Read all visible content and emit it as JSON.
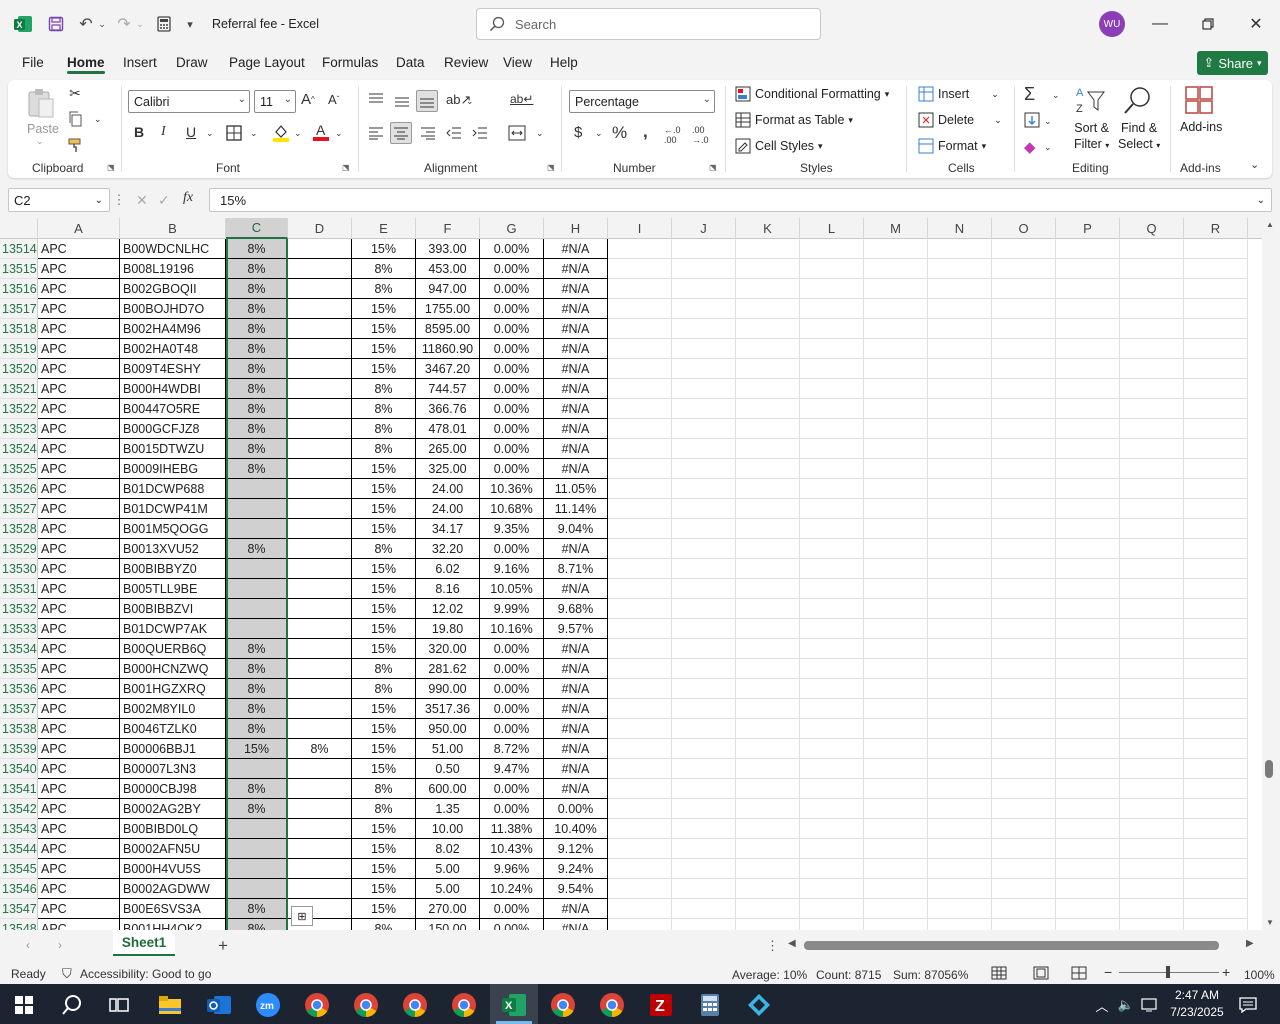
{
  "window": {
    "title": "Referral fee  -  Excel",
    "search_placeholder": "Search",
    "avatar_initials": "WU"
  },
  "menu": [
    "File",
    "Home",
    "Insert",
    "Draw",
    "Page Layout",
    "Formulas",
    "Data",
    "Review",
    "View",
    "Help"
  ],
  "share_label": "Share",
  "ribbon": {
    "clipboard": {
      "paste": "Paste",
      "label": "Clipboard"
    },
    "font": {
      "name": "Calibri",
      "size": "11",
      "label": "Font"
    },
    "alignment": {
      "label": "Alignment"
    },
    "number": {
      "format": "Percentage",
      "label": "Number"
    },
    "styles": {
      "conditional": "Conditional Formatting",
      "format_table": "Format as Table",
      "cell_styles": "Cell Styles",
      "label": "Styles"
    },
    "cells": {
      "insert": "Insert",
      "delete": "Delete",
      "format": "Format",
      "label": "Cells"
    },
    "editing": {
      "sort1": "Sort &",
      "sort2": "Filter",
      "find1": "Find &",
      "find2": "Select",
      "label": "Editing"
    },
    "addins": {
      "btn": "Add-ins",
      "label": "Add-ins"
    }
  },
  "formula_bar": {
    "cell_ref": "C2",
    "content": "15%",
    "fx": "fx"
  },
  "columns": [
    "A",
    "B",
    "C",
    "D",
    "E",
    "F",
    "G",
    "H",
    "I",
    "J",
    "K",
    "L",
    "M",
    "N",
    "O",
    "P",
    "Q",
    "R"
  ],
  "rows": [
    {
      "n": "13514",
      "a": "APC",
      "b": "B00WDCNLHC",
      "c": "8%",
      "d": "",
      "e": "15%",
      "f": "393.00",
      "g": "0.00%",
      "h": "#N/A"
    },
    {
      "n": "13515",
      "a": "APC",
      "b": "B008L19196",
      "c": "8%",
      "d": "",
      "e": "8%",
      "f": "453.00",
      "g": "0.00%",
      "h": "#N/A"
    },
    {
      "n": "13516",
      "a": "APC",
      "b": "B002GBOQII",
      "c": "8%",
      "d": "",
      "e": "8%",
      "f": "947.00",
      "g": "0.00%",
      "h": "#N/A"
    },
    {
      "n": "13517",
      "a": "APC",
      "b": "B00BOJHD7O",
      "c": "8%",
      "d": "",
      "e": "15%",
      "f": "1755.00",
      "g": "0.00%",
      "h": "#N/A"
    },
    {
      "n": "13518",
      "a": "APC",
      "b": "B002HA4M96",
      "c": "8%",
      "d": "",
      "e": "15%",
      "f": "8595.00",
      "g": "0.00%",
      "h": "#N/A"
    },
    {
      "n": "13519",
      "a": "APC",
      "b": "B002HA0T48",
      "c": "8%",
      "d": "",
      "e": "15%",
      "f": "11860.90",
      "g": "0.00%",
      "h": "#N/A"
    },
    {
      "n": "13520",
      "a": "APC",
      "b": "B009T4ESHY",
      "c": "8%",
      "d": "",
      "e": "15%",
      "f": "3467.20",
      "g": "0.00%",
      "h": "#N/A"
    },
    {
      "n": "13521",
      "a": "APC",
      "b": "B000H4WDBI",
      "c": "8%",
      "d": "",
      "e": "8%",
      "f": "744.57",
      "g": "0.00%",
      "h": "#N/A"
    },
    {
      "n": "13522",
      "a": "APC",
      "b": "B00447O5RE",
      "c": "8%",
      "d": "",
      "e": "8%",
      "f": "366.76",
      "g": "0.00%",
      "h": "#N/A"
    },
    {
      "n": "13523",
      "a": "APC",
      "b": "B000GCFJZ8",
      "c": "8%",
      "d": "",
      "e": "8%",
      "f": "478.01",
      "g": "0.00%",
      "h": "#N/A"
    },
    {
      "n": "13524",
      "a": "APC",
      "b": "B0015DTWZU",
      "c": "8%",
      "d": "",
      "e": "8%",
      "f": "265.00",
      "g": "0.00%",
      "h": "#N/A"
    },
    {
      "n": "13525",
      "a": "APC",
      "b": "B0009IHEBG",
      "c": "8%",
      "d": "",
      "e": "15%",
      "f": "325.00",
      "g": "0.00%",
      "h": "#N/A"
    },
    {
      "n": "13526",
      "a": "APC",
      "b": "B01DCWP688",
      "c": "",
      "d": "",
      "e": "15%",
      "f": "24.00",
      "g": "10.36%",
      "h": "11.05%"
    },
    {
      "n": "13527",
      "a": "APC",
      "b": "B01DCWP41M",
      "c": "",
      "d": "",
      "e": "15%",
      "f": "24.00",
      "g": "10.68%",
      "h": "11.14%"
    },
    {
      "n": "13528",
      "a": "APC",
      "b": "B001M5QOGG",
      "c": "",
      "d": "",
      "e": "15%",
      "f": "34.17",
      "g": "9.35%",
      "h": "9.04%"
    },
    {
      "n": "13529",
      "a": "APC",
      "b": "B0013XVU52",
      "c": "8%",
      "d": "",
      "e": "8%",
      "f": "32.20",
      "g": "0.00%",
      "h": "#N/A"
    },
    {
      "n": "13530",
      "a": "APC",
      "b": "B00BIBBYZ0",
      "c": "",
      "d": "",
      "e": "15%",
      "f": "6.02",
      "g": "9.16%",
      "h": "8.71%"
    },
    {
      "n": "13531",
      "a": "APC",
      "b": "B005TLL9BE",
      "c": "",
      "d": "",
      "e": "15%",
      "f": "8.16",
      "g": "10.05%",
      "h": "#N/A"
    },
    {
      "n": "13532",
      "a": "APC",
      "b": "B00BIBBZVI",
      "c": "",
      "d": "",
      "e": "15%",
      "f": "12.02",
      "g": "9.99%",
      "h": "9.68%"
    },
    {
      "n": "13533",
      "a": "APC",
      "b": "B01DCWP7AK",
      "c": "",
      "d": "",
      "e": "15%",
      "f": "19.80",
      "g": "10.16%",
      "h": "9.57%"
    },
    {
      "n": "13534",
      "a": "APC",
      "b": "B00QUERB6Q",
      "c": "8%",
      "d": "",
      "e": "15%",
      "f": "320.00",
      "g": "0.00%",
      "h": "#N/A"
    },
    {
      "n": "13535",
      "a": "APC",
      "b": "B000HCNZWQ",
      "c": "8%",
      "d": "",
      "e": "8%",
      "f": "281.62",
      "g": "0.00%",
      "h": "#N/A"
    },
    {
      "n": "13536",
      "a": "APC",
      "b": "B001HGZXRQ",
      "c": "8%",
      "d": "",
      "e": "8%",
      "f": "990.00",
      "g": "0.00%",
      "h": "#N/A"
    },
    {
      "n": "13537",
      "a": "APC",
      "b": "B002M8YIL0",
      "c": "8%",
      "d": "",
      "e": "15%",
      "f": "3517.36",
      "g": "0.00%",
      "h": "#N/A"
    },
    {
      "n": "13538",
      "a": "APC",
      "b": "B0046TZLK0",
      "c": "8%",
      "d": "",
      "e": "15%",
      "f": "950.00",
      "g": "0.00%",
      "h": "#N/A"
    },
    {
      "n": "13539",
      "a": "APC",
      "b": "B00006BBJ1",
      "c": "15%",
      "d": "8%",
      "e": "15%",
      "f": "51.00",
      "g": "8.72%",
      "h": "#N/A"
    },
    {
      "n": "13540",
      "a": "APC",
      "b": "B00007L3N3",
      "c": "",
      "d": "",
      "e": "15%",
      "f": "0.50",
      "g": "9.47%",
      "h": "#N/A"
    },
    {
      "n": "13541",
      "a": "APC",
      "b": "B0000CBJ98",
      "c": "8%",
      "d": "",
      "e": "8%",
      "f": "600.00",
      "g": "0.00%",
      "h": "#N/A"
    },
    {
      "n": "13542",
      "a": "APC",
      "b": "B0002AG2BY",
      "c": "8%",
      "d": "",
      "e": "8%",
      "f": "1.35",
      "g": "0.00%",
      "h": "0.00%"
    },
    {
      "n": "13543",
      "a": "APC",
      "b": "B00BIBD0LQ",
      "c": "",
      "d": "",
      "e": "15%",
      "f": "10.00",
      "g": "11.38%",
      "h": "10.40%"
    },
    {
      "n": "13544",
      "a": "APC",
      "b": "B0002AFN5U",
      "c": "",
      "d": "",
      "e": "15%",
      "f": "8.02",
      "g": "10.43%",
      "h": "9.12%"
    },
    {
      "n": "13545",
      "a": "APC",
      "b": "B000H4VU5S",
      "c": "",
      "d": "",
      "e": "15%",
      "f": "5.00",
      "g": "9.96%",
      "h": "9.24%"
    },
    {
      "n": "13546",
      "a": "APC",
      "b": "B0002AGDWW",
      "c": "",
      "d": "",
      "e": "15%",
      "f": "5.00",
      "g": "10.24%",
      "h": "9.54%"
    },
    {
      "n": "13547",
      "a": "APC",
      "b": "B00E6SVS3A",
      "c": "8%",
      "d": "",
      "e": "15%",
      "f": "270.00",
      "g": "0.00%",
      "h": "#N/A"
    },
    {
      "n": "13548",
      "a": "APC",
      "b": "B001HH4OK2",
      "c": "8%",
      "d": "",
      "e": "8%",
      "f": "150.00",
      "g": "0.00%",
      "h": "#N/A"
    }
  ],
  "sheet_tab": "Sheet1",
  "status": {
    "ready": "Ready",
    "accessibility": "Accessibility: Good to go",
    "average": "Average: 10%",
    "count": "Count: 8715",
    "sum": "Sum: 87056%",
    "zoom": "100%"
  },
  "taskbar": {
    "time": "2:47 AM",
    "date": "7/23/2025"
  },
  "colors": {
    "excel_green": "#217346",
    "selected_col": "#d0d0d0",
    "taskbar": "#1c2431"
  }
}
